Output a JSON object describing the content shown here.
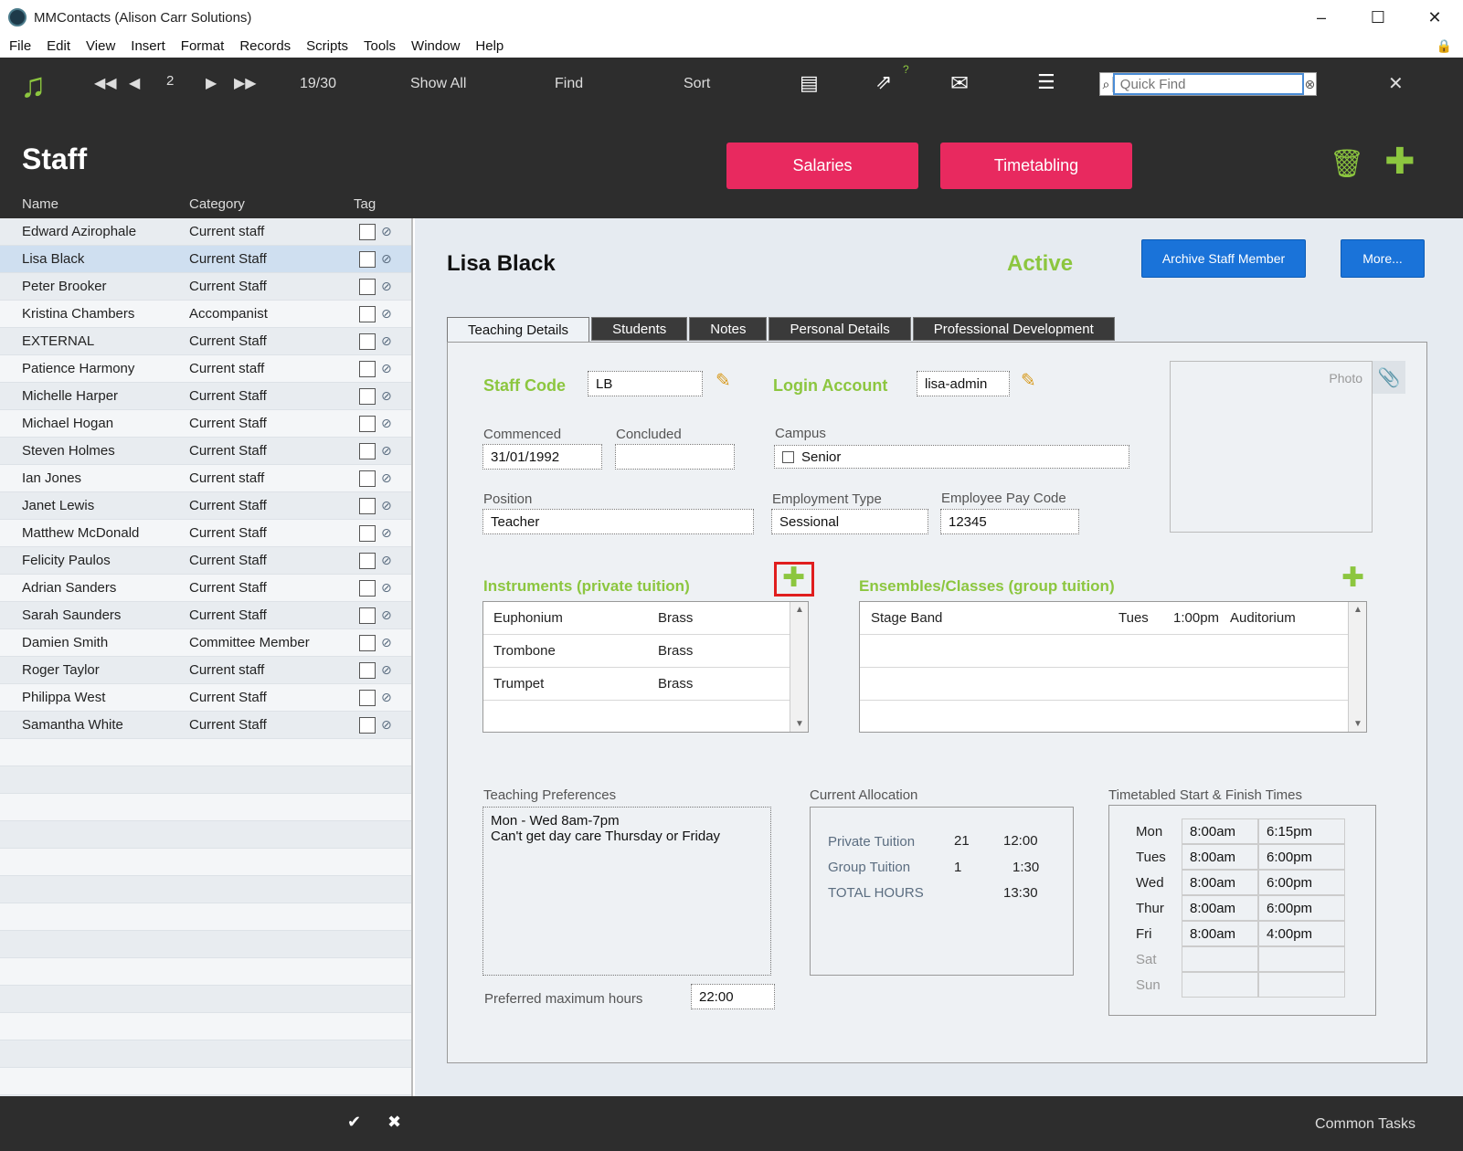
{
  "window": {
    "title": "MMContacts (Alison Carr Solutions)",
    "controls": [
      "–",
      "☐",
      "✕"
    ]
  },
  "menu": [
    "File",
    "Edit",
    "View",
    "Insert",
    "Format",
    "Records",
    "Scripts",
    "Tools",
    "Window",
    "Help"
  ],
  "toolbar": {
    "record_number": "2",
    "record_count": "19/30",
    "show_all": "Show All",
    "find": "Find",
    "sort": "Sort",
    "quick_find_placeholder": "Quick Find"
  },
  "header": {
    "title": "Staff",
    "salaries": "Salaries",
    "timetabling": "Timetabling",
    "col_name": "Name",
    "col_category": "Category",
    "col_tag": "Tag"
  },
  "staff_list": [
    {
      "name": "Edward Azirophale",
      "category": "Current staff"
    },
    {
      "name": "Lisa Black",
      "category": "Current Staff"
    },
    {
      "name": "Peter Brooker",
      "category": "Current Staff"
    },
    {
      "name": "Kristina Chambers",
      "category": "Accompanist"
    },
    {
      "name": " EXTERNAL",
      "category": "Current Staff"
    },
    {
      "name": "Patience Harmony",
      "category": "Current staff"
    },
    {
      "name": "Michelle Harper",
      "category": "Current Staff"
    },
    {
      "name": "Michael Hogan",
      "category": "Current Staff"
    },
    {
      "name": "Steven Holmes",
      "category": "Current Staff"
    },
    {
      "name": "Ian Jones",
      "category": "Current staff"
    },
    {
      "name": "Janet Lewis",
      "category": "Current Staff"
    },
    {
      "name": "Matthew McDonald",
      "category": "Current Staff"
    },
    {
      "name": "Felicity Paulos",
      "category": "Current Staff"
    },
    {
      "name": "Adrian Sanders",
      "category": "Current Staff"
    },
    {
      "name": "Sarah Saunders",
      "category": "Current Staff"
    },
    {
      "name": "Damien Smith",
      "category": "Committee Member"
    },
    {
      "name": "Roger Taylor",
      "category": "Current staff"
    },
    {
      "name": "Philippa West",
      "category": "Current Staff"
    },
    {
      "name": "Samantha White",
      "category": "Current Staff"
    }
  ],
  "record": {
    "name": "Lisa Black",
    "status": "Active",
    "archive_button": "Archive Staff Member",
    "more_button": "More...",
    "tabs": [
      "Teaching Details",
      "Students",
      "Notes",
      "Personal Details",
      "Professional Development"
    ],
    "staff_code_label": "Staff Code",
    "staff_code": "LB",
    "login_label": "Login Account",
    "login": "lisa-admin",
    "photo_label": "Photo",
    "commenced_label": "Commenced",
    "commenced": "31/01/1992",
    "concluded_label": "Concluded",
    "concluded": "",
    "campus_label": "Campus",
    "campus": "Senior",
    "position_label": "Position",
    "position": "Teacher",
    "employment_type_label": "Employment Type",
    "employment_type": "Sessional",
    "pay_code_label": "Employee Pay Code",
    "pay_code": "12345",
    "instruments_label": "Instruments (private tuition)",
    "instruments": [
      {
        "name": "Euphonium",
        "family": "Brass"
      },
      {
        "name": "Trombone",
        "family": "Brass"
      },
      {
        "name": "Trumpet",
        "family": "Brass"
      }
    ],
    "ensembles_label": "Ensembles/Classes (group tuition)",
    "ensembles": [
      {
        "name": "Stage Band",
        "day": "Tues",
        "time": "1:00pm",
        "venue": "Auditorium"
      }
    ],
    "prefs_label": "Teaching Preferences",
    "prefs_line1": "Mon - Wed 8am-7pm",
    "prefs_line2": "Can't get day care Thursday or Friday",
    "max_hours_label": "Preferred maximum hours",
    "max_hours": "22:00",
    "allocation_label": "Current Allocation",
    "allocation": [
      {
        "label": "Private Tuition",
        "count": "21",
        "hours": "12:00"
      },
      {
        "label": "Group Tuition",
        "count": "1",
        "hours": "1:30"
      },
      {
        "label": "TOTAL HOURS",
        "count": "",
        "hours": "13:30"
      }
    ],
    "times_label": "Timetabled Start & Finish Times",
    "times": [
      {
        "day": "Mon",
        "start": "8:00am",
        "finish": "6:15pm"
      },
      {
        "day": "Tues",
        "start": "8:00am",
        "finish": "6:00pm"
      },
      {
        "day": "Wed",
        "start": "8:00am",
        "finish": "6:00pm"
      },
      {
        "day": "Thur",
        "start": "8:00am",
        "finish": "6:00pm"
      },
      {
        "day": "Fri",
        "start": "8:00am",
        "finish": "4:00pm"
      },
      {
        "day": "Sat",
        "start": "",
        "finish": ""
      },
      {
        "day": "Sun",
        "start": "",
        "finish": ""
      }
    ]
  },
  "footer": {
    "common_tasks": "Common Tasks"
  },
  "colors": {
    "accent_green": "#8cc63f",
    "pink": "#e8295f",
    "blue": "#1a73d9",
    "dark": "#2d2d2d"
  }
}
